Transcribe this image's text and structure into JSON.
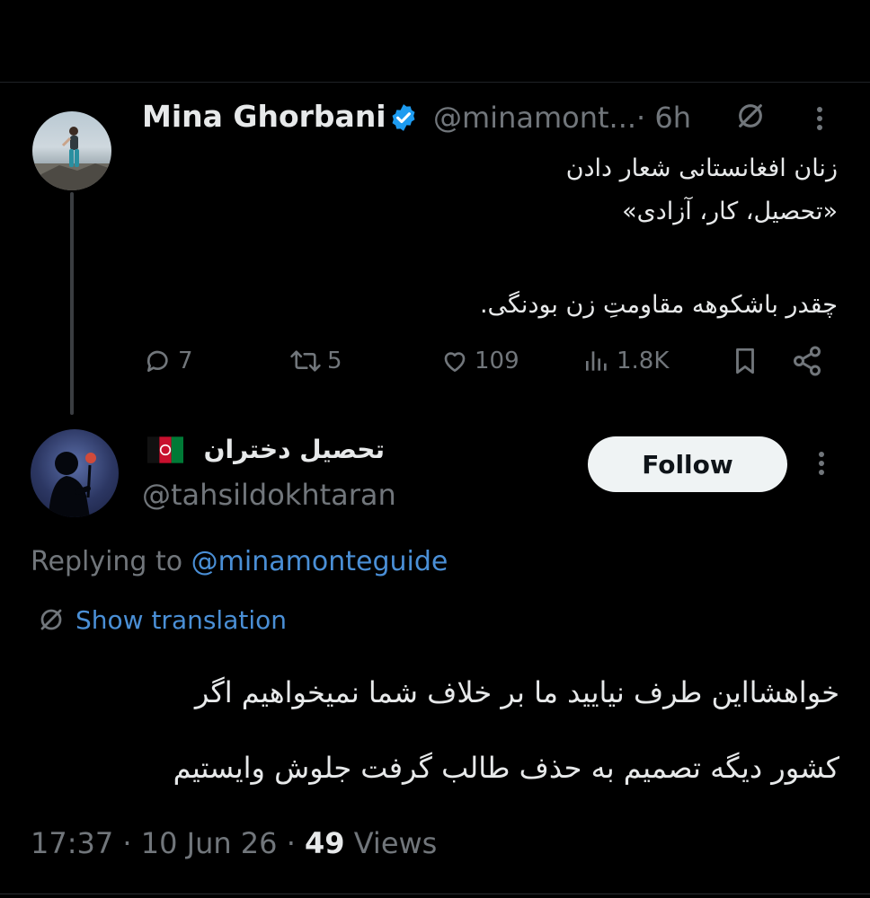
{
  "tweet": {
    "author_name": "Mina Ghorbani",
    "handle": "@minamont...",
    "time": "· 6h",
    "lines": [
      "زنان افغانستانی شعار دادن",
      "«تحصیل، کار، آزادی»",
      "چقدر باشکوهه مقاومتِ زن بودنگی."
    ],
    "actions": {
      "replies": "7",
      "reposts": "5",
      "likes": "109",
      "views": "1.8K"
    }
  },
  "reply": {
    "author_name": "تحصیل دختران",
    "handle": "@tahsildokhtaran",
    "follow_label": "Follow",
    "replying_prefix": "Replying to ",
    "replying_mention": "@minamonteguide",
    "show_translation": "Show translation",
    "lines": [
      "خواهشااین طرف نیایید ما بر خلاف شما نمیخواهیم اگر",
      "کشور دیگه تصمیم به حذف طالب گرفت جلوش وایستیم"
    ],
    "timestamp": "17:37 · 10 Jun 26 · ",
    "views_count": "49",
    "views_label": " Views"
  },
  "colors": {
    "background": "#000000",
    "text": "#e7e9ea",
    "muted": "#71767b",
    "link": "#4a8fd6",
    "verified": "#1d9bf0"
  },
  "icons": [
    "verified-badge-icon",
    "grok-icon",
    "more-icon",
    "reply-icon",
    "repost-icon",
    "like-icon",
    "views-icon",
    "bookmark-icon",
    "share-icon",
    "translate-icon",
    "afghanistan-flag-icon"
  ]
}
